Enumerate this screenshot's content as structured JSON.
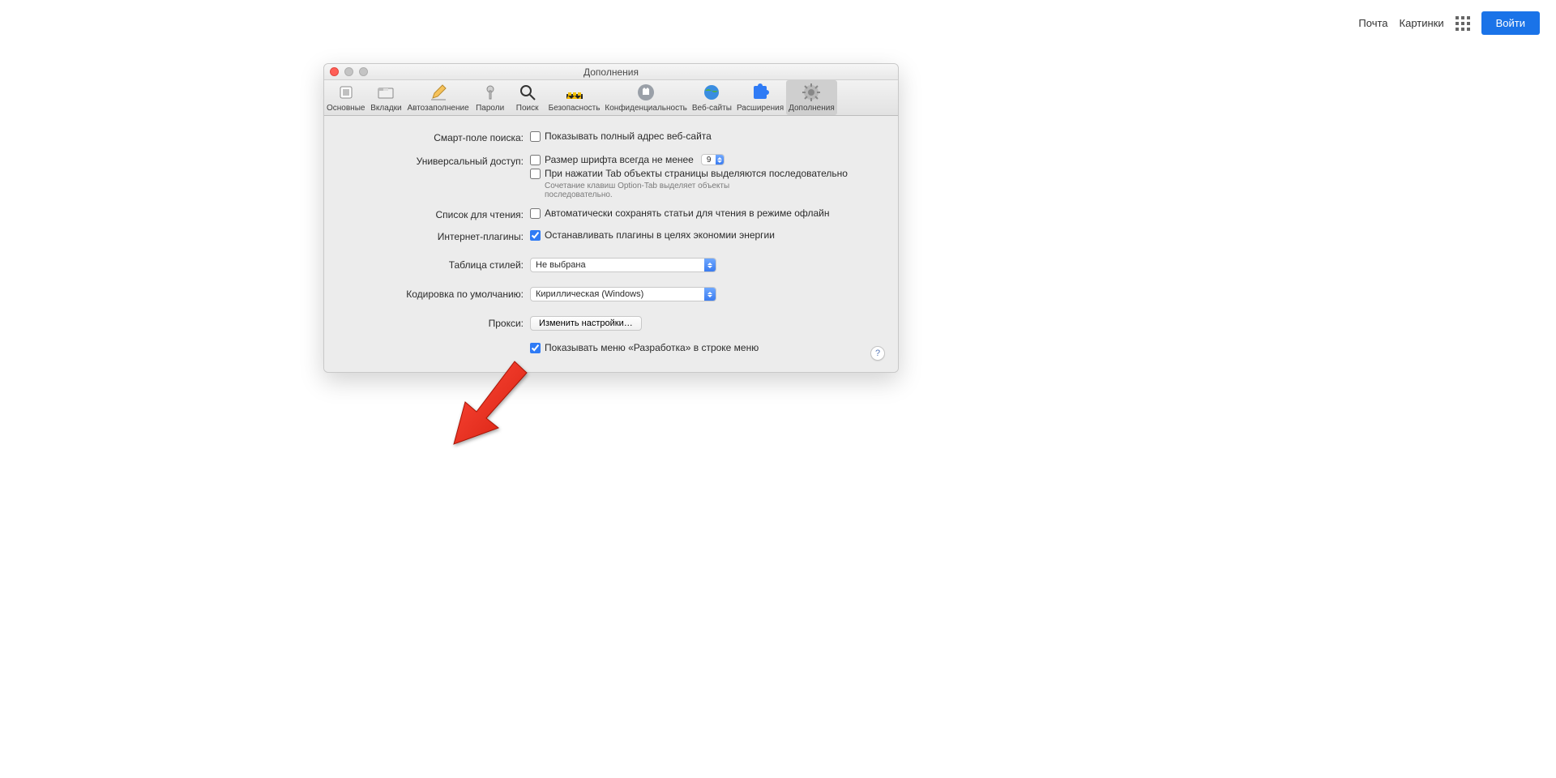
{
  "topnav": {
    "mail": "Почта",
    "images": "Картинки",
    "login": "Войти"
  },
  "window": {
    "title": "Дополнения"
  },
  "toolbar": {
    "general": "Основные",
    "tabs": "Вкладки",
    "autofill": "Автозаполнение",
    "passwords": "Пароли",
    "search": "Поиск",
    "security": "Безопасность",
    "privacy": "Конфиденциальность",
    "websites": "Веб-сайты",
    "extensions": "Расширения",
    "advanced": "Дополнения"
  },
  "labels": {
    "smart_search": "Смарт-поле поиска:",
    "accessibility": "Универсальный доступ:",
    "reading_list": "Список для чтения:",
    "plugins": "Интернет-плагины:",
    "stylesheet": "Таблица стилей:",
    "encoding": "Кодировка по умолчанию:",
    "proxies": "Прокси:"
  },
  "options": {
    "show_full_url": "Показывать полный адрес веб-сайта",
    "font_min": "Размер шрифта всегда не менее",
    "font_min_value": "9",
    "tab_highlight": "При нажатии Tab объекты страницы выделяются последовательно",
    "tab_help": "Сочетание клавиш Option-Tab выделяет объекты последовательно.",
    "reading_offline": "Автоматически сохранять статьи для чтения в режиме офлайн",
    "stop_plugins": "Останавливать плагины в целях экономии энергии",
    "stylesheet_value": "Не выбрана",
    "encoding_value": "Кириллическая (Windows)",
    "proxies_button": "Изменить настройки…",
    "show_develop": "Показывать меню «Разработка» в строке меню",
    "help": "?"
  }
}
